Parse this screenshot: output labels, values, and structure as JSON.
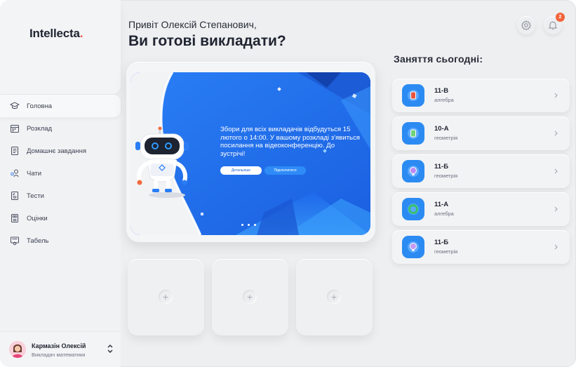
{
  "app": {
    "logo_text": "Intellecta",
    "logo_dot": ".",
    "accent": "#e8553f",
    "brand_blue": "#1b6ff0"
  },
  "sidebar": {
    "items": [
      {
        "label": "Головна",
        "icon": "graduation-cap-icon",
        "active": true
      },
      {
        "label": "Розклад",
        "icon": "calendar-icon",
        "active": false
      },
      {
        "label": "Домашнє завдання",
        "icon": "homework-book-icon",
        "active": false
      },
      {
        "label": "Чати",
        "icon": "chat-users-icon",
        "active": false
      },
      {
        "label": "Тести",
        "icon": "tests-document-icon",
        "active": false
      },
      {
        "label": "Оцінки",
        "icon": "grades-icon",
        "active": false
      },
      {
        "label": "Табель",
        "icon": "certificate-icon",
        "active": false
      }
    ]
  },
  "user": {
    "name": "Кармазін Олексій",
    "role": "Викладач математики"
  },
  "header": {
    "greeting_line1": "Привіт Олексій Степанович,",
    "greeting_line2": "Ви готові викладати?",
    "notifications_count": "2"
  },
  "banner": {
    "text": "Збори для всіх викладачів відбудуться 15 лютого о 14:00. У вашому розкладі з'явиться посилання на відеоконференцію. До зустрічі!",
    "details_button": "Детальніше",
    "join_button": "Підключитися",
    "slide_count": 3
  },
  "lessons": {
    "title": "Заняття сьогодні:",
    "items": [
      {
        "class": "11-В",
        "subject": "алгебра",
        "icon_color": "#e8553f"
      },
      {
        "class": "10-А",
        "subject": "геометрія",
        "icon_color": "#6fd37a"
      },
      {
        "class": "11-Б",
        "subject": "геометрія",
        "icon_color": "#b98af2"
      },
      {
        "class": "11-А",
        "subject": "алгебра",
        "icon_color": "#35c26b"
      },
      {
        "class": "11-Б",
        "subject": "геометрія",
        "icon_color": "#c59af5"
      }
    ]
  }
}
